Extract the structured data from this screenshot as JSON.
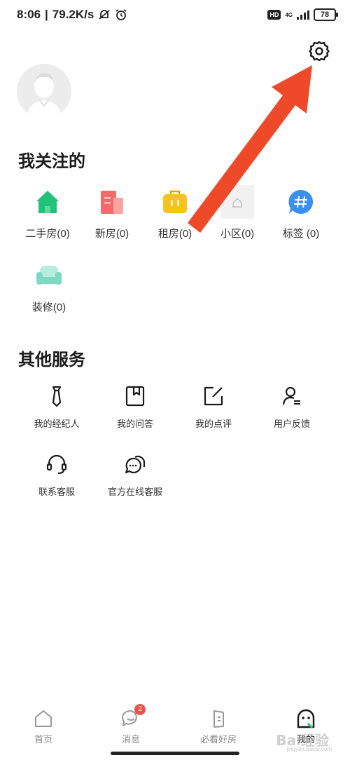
{
  "status_bar": {
    "time": "8:06",
    "speed": "79.2K/s",
    "hd": "HD",
    "network": "4G",
    "battery": "78"
  },
  "header": {
    "settings_icon": "gear-icon",
    "avatar_icon": "default-avatar"
  },
  "follow": {
    "title": "我关注的",
    "items": [
      {
        "label": "二手房(0)",
        "icon": "house-icon",
        "color": "#22c17a"
      },
      {
        "label": "新房(0)",
        "icon": "building-icon",
        "color": "#f26b6b"
      },
      {
        "label": "租房(0)",
        "icon": "suitcase-icon",
        "color": "#f7c21b"
      },
      {
        "label": "小区(0)",
        "icon": "community-icon",
        "color": "#e6e6e6"
      },
      {
        "label": "标签 (0)",
        "icon": "hashtag-icon",
        "color": "#3a8ff0"
      },
      {
        "label": "装修(0)",
        "icon": "sofa-icon",
        "color": "#7dd9c0"
      }
    ]
  },
  "services": {
    "title": "其他服务",
    "items": [
      {
        "label": "我的经纪人",
        "icon": "tie-icon"
      },
      {
        "label": "我的问答",
        "icon": "book-icon"
      },
      {
        "label": "我的点评",
        "icon": "edit-icon"
      },
      {
        "label": "用户反馈",
        "icon": "user-feedback-icon"
      },
      {
        "label": "联系客服",
        "icon": "headset-icon"
      },
      {
        "label": "官方在线客服",
        "icon": "chat-icon"
      }
    ]
  },
  "tabbar": {
    "tabs": [
      {
        "label": "首页",
        "icon": "home-icon"
      },
      {
        "label": "消息",
        "icon": "message-icon",
        "badge": "2"
      },
      {
        "label": "必看好房",
        "icon": "door-icon"
      },
      {
        "label": "我的",
        "icon": "profile-icon"
      }
    ]
  },
  "watermark": {
    "text": "Bai经验",
    "sub": "jingyan.baidu.com"
  },
  "colors": {
    "accent": "#22c17a",
    "arrow": "#ee4a2a",
    "badge": "#f0504b"
  }
}
